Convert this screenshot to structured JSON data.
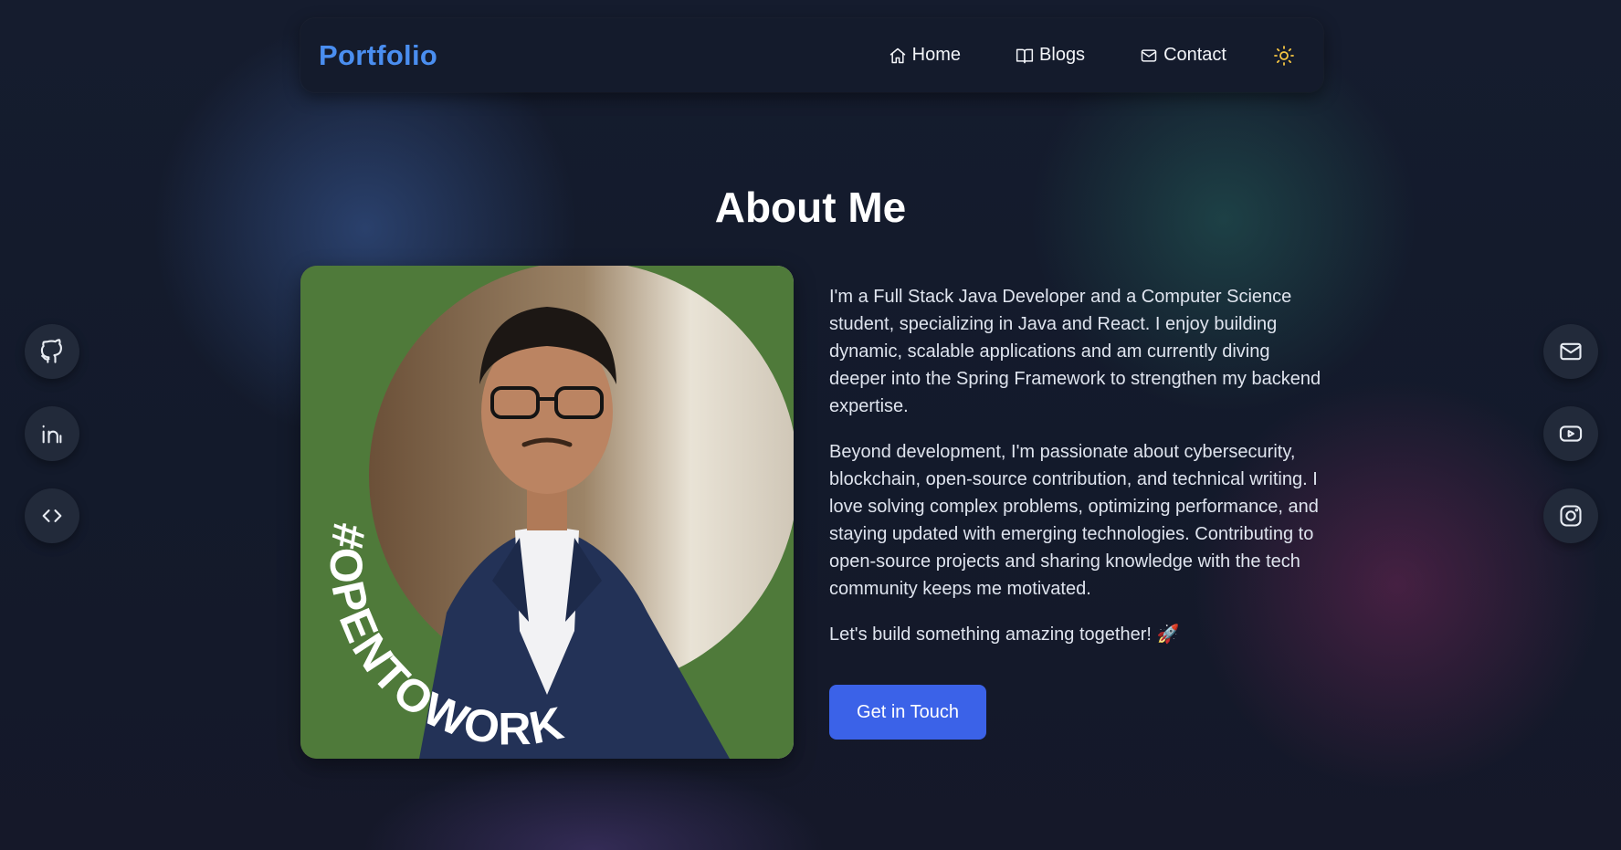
{
  "nav": {
    "brand": "Portfolio",
    "links": [
      {
        "label": "Home",
        "icon": "home-icon"
      },
      {
        "label": "Blogs",
        "icon": "book-icon"
      },
      {
        "label": "Contact",
        "icon": "mail-icon"
      }
    ],
    "theme_icon": "sun-icon"
  },
  "about": {
    "title": "About Me",
    "paragraphs": [
      "I'm a Full Stack Java Developer and a Computer Science student, specializing in Java and React. I enjoy building dynamic, scalable applications and am currently diving deeper into the Spring Framework to strengthen my backend expertise.",
      "Beyond development, I'm passionate about cybersecurity, blockchain, open-source contribution, and technical writing. I love solving complex problems, optimizing performance, and staying updated with emerging technologies. Contributing to open-source projects and sharing knowledge with the tech community keeps me motivated.",
      "Let's build something amazing together! 🚀"
    ],
    "cta_label": "Get in Touch",
    "photo_badge": "#OPENTOWORK"
  },
  "social_left": [
    {
      "icon": "github-icon"
    },
    {
      "icon": "linkedin-icon"
    },
    {
      "icon": "code-icon"
    }
  ],
  "social_right": [
    {
      "icon": "mail-icon"
    },
    {
      "icon": "youtube-icon"
    },
    {
      "icon": "instagram-icon"
    }
  ],
  "colors": {
    "brand": "#4a8ef0",
    "cta": "#3b62e8",
    "sun": "#f5c542",
    "badge_green": "#4f7a3a"
  }
}
